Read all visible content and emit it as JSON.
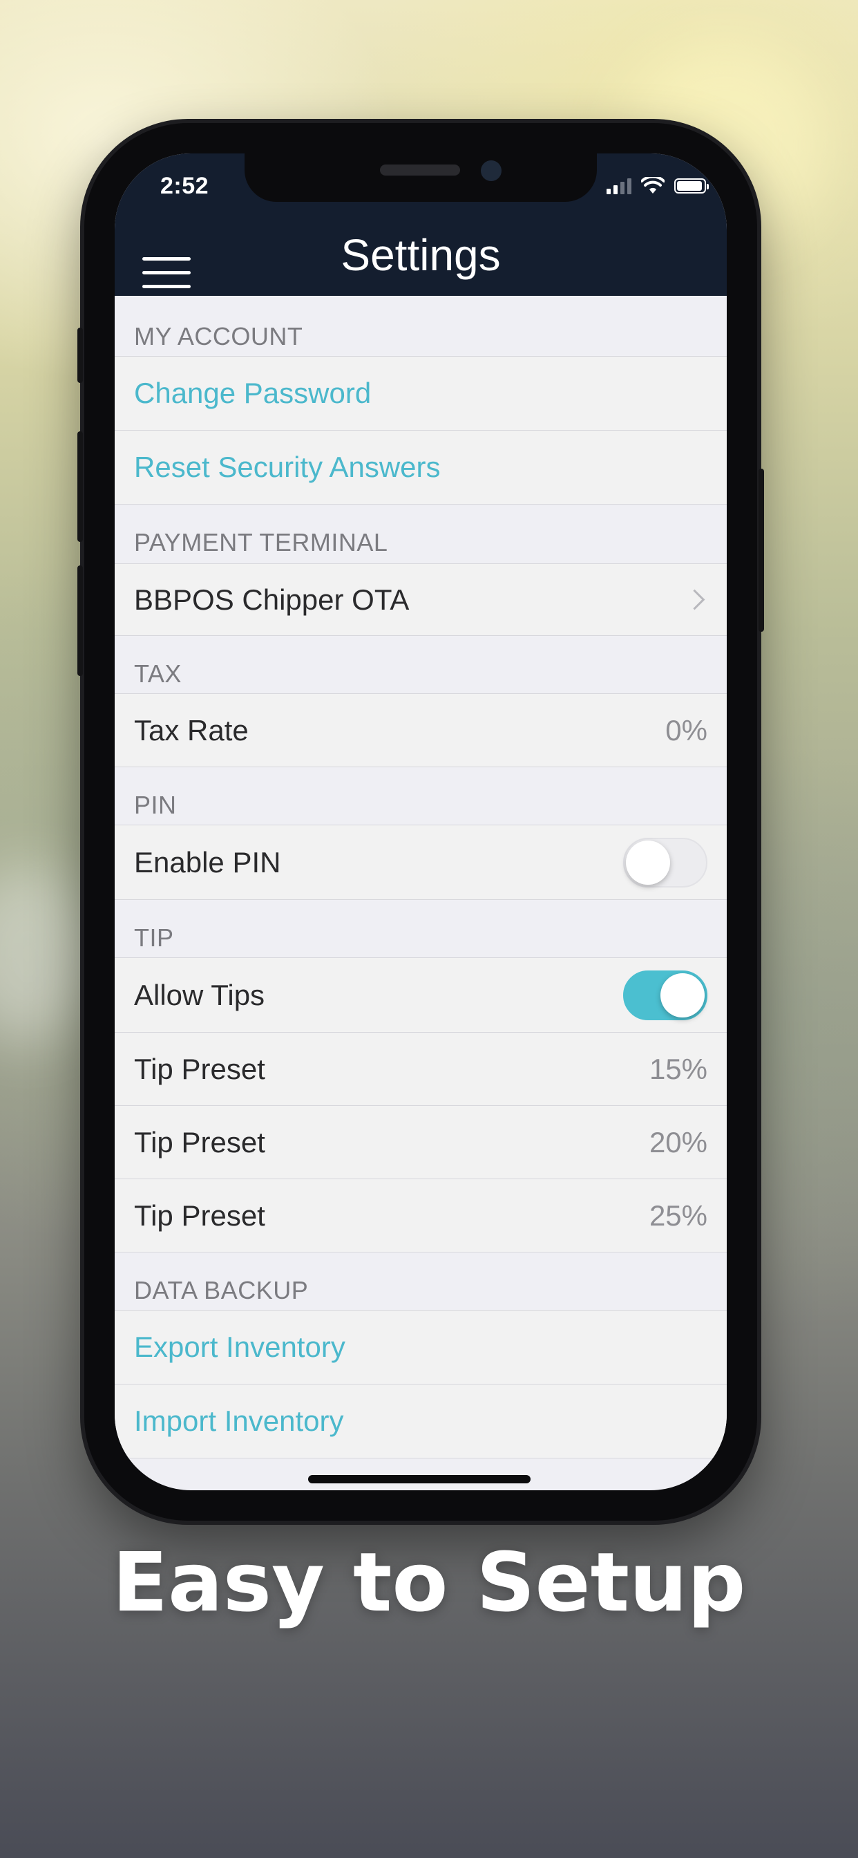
{
  "status_bar": {
    "time": "2:52"
  },
  "nav": {
    "title": "Settings",
    "menu_icon": "hamburger-menu-icon"
  },
  "sections": {
    "my_account": {
      "header": "MY ACCOUNT",
      "change_password": "Change Password",
      "reset_security": "Reset Security Answers"
    },
    "payment_terminal": {
      "header": "PAYMENT TERMINAL",
      "device": "BBPOS Chipper OTA"
    },
    "tax": {
      "header": "TAX",
      "label": "Tax Rate",
      "value": "0%"
    },
    "pin": {
      "header": "PIN",
      "label": "Enable PIN",
      "enabled": false
    },
    "tip": {
      "header": "TIP",
      "allow_label": "Allow Tips",
      "allow_enabled": true,
      "presets": [
        {
          "label": "Tip Preset",
          "value": "15%"
        },
        {
          "label": "Tip Preset",
          "value": "20%"
        },
        {
          "label": "Tip Preset",
          "value": "25%"
        }
      ]
    },
    "data_backup": {
      "header": "DATA BACKUP",
      "export": "Export Inventory",
      "import": "Import Inventory"
    }
  },
  "colors": {
    "nav_bg": "#141e2f",
    "accent": "#4bb8cc",
    "toggle_on": "#4bbfd0"
  },
  "caption": "Easy to Setup"
}
